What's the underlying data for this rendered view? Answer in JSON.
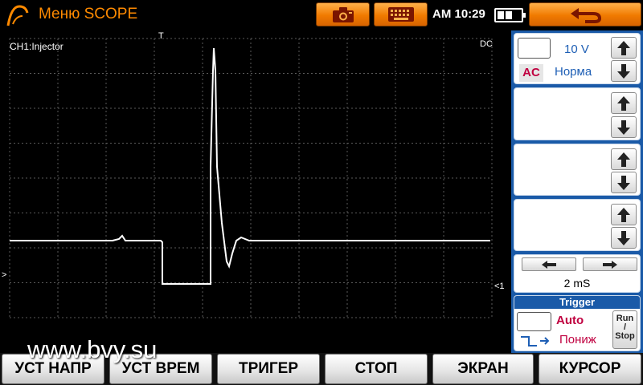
{
  "header": {
    "title": "Меню SCOPE",
    "clock": "AM 10:29",
    "accent_color": "#f07a00",
    "icons": [
      "scope-logo-icon",
      "camera-icon",
      "keyboard-icon",
      "back-arrow-icon",
      "battery-icon"
    ]
  },
  "screen": {
    "channel_label": "CH1:Injector",
    "trigger_time_marker": "T",
    "coupling_indicator": "DC",
    "trigger_level_marker": ">",
    "channel_level_marker": "<1",
    "grid_divisions": {
      "x": 10,
      "y": 8
    },
    "trace_color": "#ffffff",
    "grid_color": "#5a5a5a"
  },
  "panel": {
    "ch1": {
      "volts_per_div": "10 V",
      "coupling": "AC",
      "mode": "Норма"
    },
    "timebase": "2 mS",
    "trigger": {
      "header": "Trigger",
      "mode": "Auto",
      "edge": "Пониж",
      "run_stop_label": [
        "Run",
        "/",
        "Stop"
      ]
    }
  },
  "toolbar": {
    "volt_setup": "УСТ НАПР",
    "time_setup": "УСТ ВРЕМ",
    "trigger": "ТРИГЕР",
    "stop": "СТОП",
    "screen": "ЭКРАН",
    "cursor": "КУРСОР"
  },
  "watermark": "www.bvy.su"
}
